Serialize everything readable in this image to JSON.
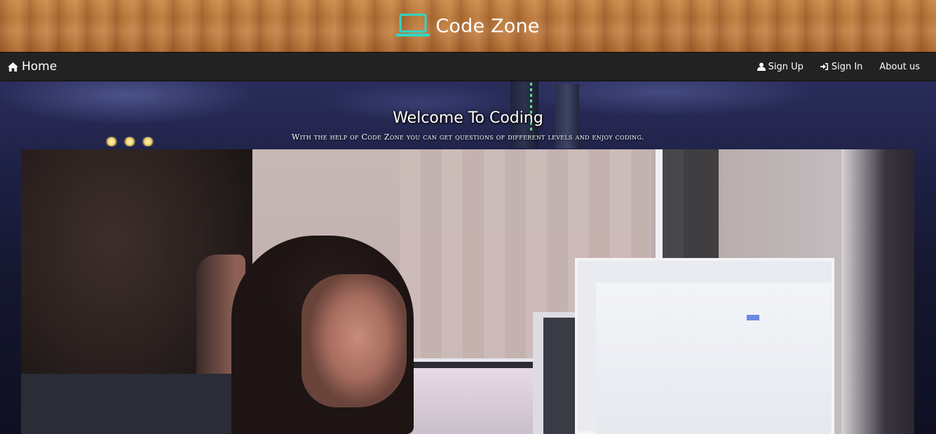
{
  "header": {
    "brand_name": "Code Zone",
    "brand_icon": "laptop-icon",
    "brand_icon_color": "#2fd8c8"
  },
  "navbar": {
    "home_label": "Home",
    "home_icon": "home-icon",
    "links": [
      {
        "label": "Sign Up",
        "icon": "user-icon"
      },
      {
        "label": "Sign In",
        "icon": "sign-in-icon"
      },
      {
        "label": "About us",
        "icon": ""
      }
    ]
  },
  "hero": {
    "title": "Welcome To Coding",
    "subtitle": "With the help of Code Zone you can get questions of different levels and enjoy coding."
  },
  "colors": {
    "navbar_bg": "#222222",
    "accent": "#2fd8c8",
    "text": "#ffffff"
  }
}
